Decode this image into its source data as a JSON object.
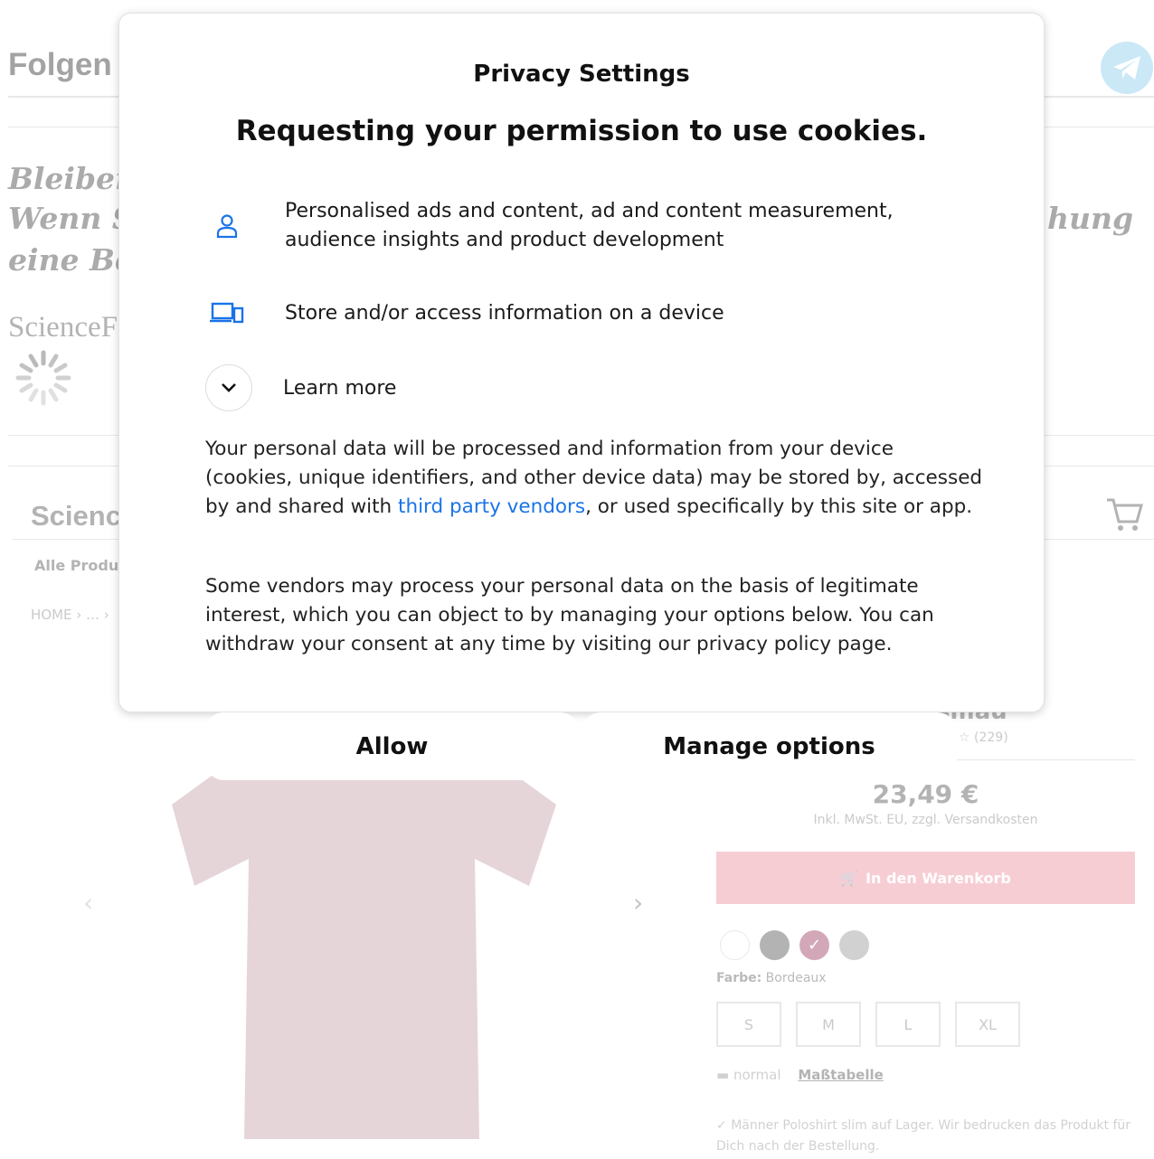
{
  "background": {
    "follow_label": "Folgen",
    "lines": [
      "Bleiben",
      "Wenn S",
      "eine Be"
    ],
    "line_right": "hung",
    "site_name": "ScienceF",
    "shop_brand": "Scienc",
    "nav_all": "Alle Produ",
    "breadcrumb": "HOME ›  …  ›",
    "product_name_fragment": "smau",
    "reviews": "(229)",
    "price": "23,49 €",
    "tax_note": "Inkl. MwSt. EU, zzgl. Versandkosten",
    "add_to_cart": "In den Warenkorb",
    "color_label": "Farbe:",
    "color_value": "Bordeaux",
    "sizes": [
      "S",
      "M",
      "L",
      "XL"
    ],
    "fit_label": "normal",
    "size_chart": "Maßtabelle",
    "stock_note": "Männer Poloshirt slim auf Lager. Wir bedrucken das Produkt für Dich nach der Bestellung.",
    "colors": {
      "accent": "#ee8fa0",
      "swatch_white": "#ffffff",
      "swatch_dark": "#555555",
      "swatch_bordeaux": "#9b3e64",
      "swatch_grey": "#999999",
      "shirt": "#c4a2a8"
    }
  },
  "modal": {
    "title": "Privacy Settings",
    "heading": "Requesting your permission to use cookies.",
    "purposes": [
      {
        "icon": "person-icon",
        "text_line1": "Personalised ads and content, ad and content measurement,",
        "text_line2": "audience insights and product development"
      },
      {
        "icon": "devices-icon",
        "text_line1": "Store and/or access information on a device",
        "text_line2": ""
      }
    ],
    "learn_more": "Learn more",
    "paragraph1_before": "Your personal data will be processed and information from your device (cookies, unique identifiers, and other device data) may be stored by, accessed by and shared with ",
    "paragraph1_link": "third party vendors",
    "paragraph1_after": ", or used specifically by this site or app.",
    "paragraph2": "Some vendors may process your personal data on the basis of legitimate interest, which you can object to by managing your options below. You can withdraw your consent at any time by visiting our privacy policy page.",
    "allow_label": "Allow",
    "manage_label": "Manage options",
    "colors": {
      "icon_blue": "#1a73e8",
      "link_blue": "#1a73e8"
    }
  }
}
